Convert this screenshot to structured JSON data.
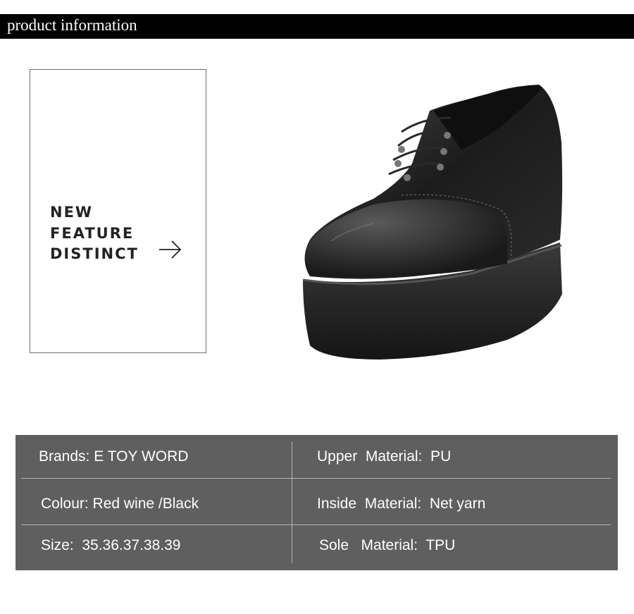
{
  "header": {
    "title": "product information"
  },
  "feature_box": {
    "lines": [
      "NEW",
      "FEATURE",
      "DISTINCT"
    ],
    "icon": "arrow-right-icon"
  },
  "product_image": {
    "subject": "shoe-icon"
  },
  "specs": {
    "brand": "Brands: E TOY WORD",
    "upper_material": "Upper  Material:  PU",
    "colour": "Colour: Red wine /Black",
    "inside_material": "Inside  Material:  Net yarn",
    "size": "Size:  35.36.37.38.39",
    "sole_material": "Sole   Material:  TPU"
  },
  "colors": {
    "header_bg": "#000000",
    "table_bg": "#5f5f5f",
    "table_text": "#ffffff",
    "divider": "#b4b4b4"
  }
}
